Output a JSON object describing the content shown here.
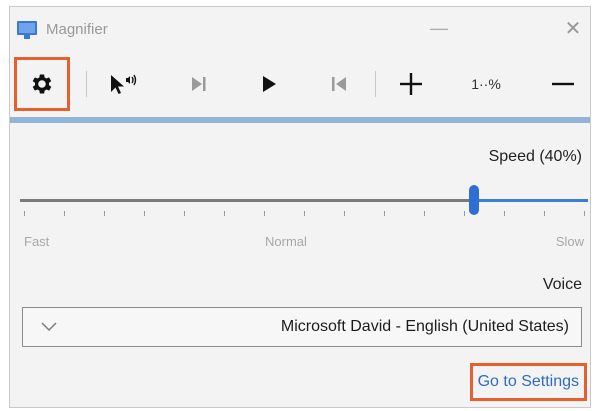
{
  "window": {
    "title": "Magnifier",
    "minimize_glyph": "—",
    "close_glyph": "✕"
  },
  "toolbar": {
    "items": [
      {
        "name": "settings-button",
        "icon": "gear-icon",
        "highlighted": true
      },
      {
        "name": "read-from-here-button",
        "icon": "pointer-speaker-icon"
      },
      {
        "name": "next-sentence-button",
        "icon": "skip-next-icon"
      },
      {
        "name": "play-button",
        "icon": "play-icon"
      },
      {
        "name": "previous-sentence-button",
        "icon": "skip-previous-icon"
      },
      {
        "name": "zoom-in-button",
        "icon": "plus-icon"
      },
      {
        "name": "zoom-percent-button",
        "icon": "zoom-percent-icon",
        "label": "1··%"
      },
      {
        "name": "zoom-out-button",
        "icon": "minus-icon"
      }
    ]
  },
  "speed": {
    "label": "Speed (40%)",
    "value_percent": 40,
    "scale_labels": {
      "fast": "Fast",
      "normal": "Normal",
      "slow": "Slow"
    }
  },
  "voice": {
    "label": "Voice",
    "selected": "Microsoft David - English (United States)",
    "chevron_icon": "chevron-down-icon"
  },
  "footer": {
    "settings_link": "Go to Settings",
    "highlighted": true
  },
  "colors": {
    "highlight": "#e4602f",
    "accent": "#2d6fd3",
    "link": "#2f6cc0",
    "accent_line": "#93b4d6"
  }
}
